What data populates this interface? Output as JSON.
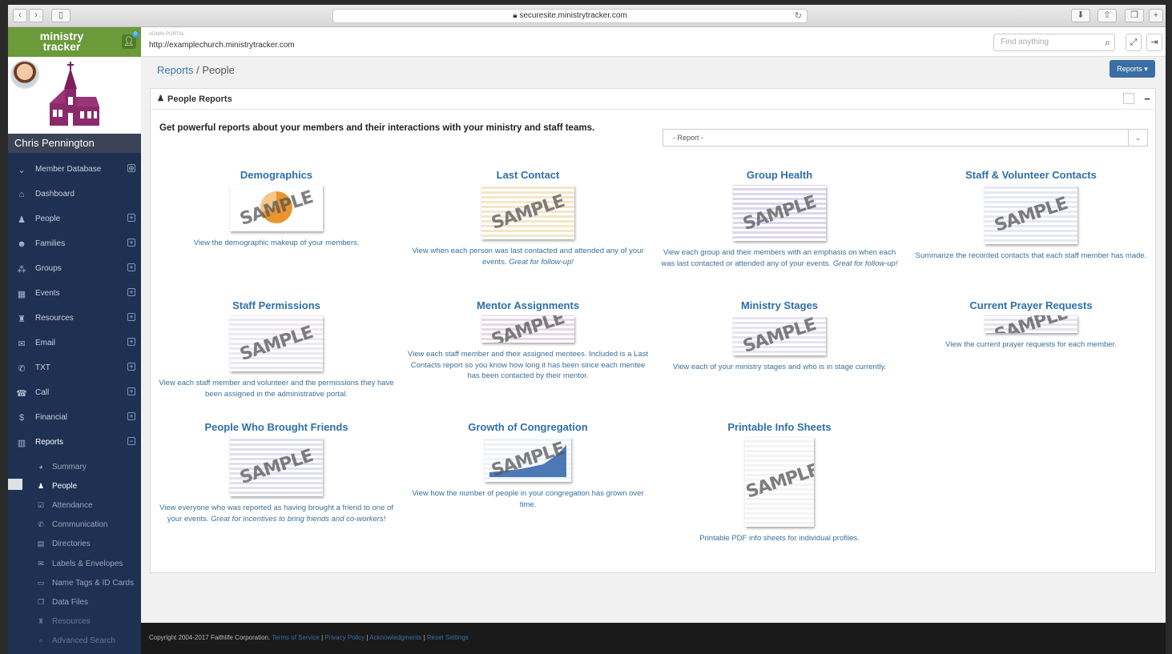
{
  "browser": {
    "address": "securesite.ministrytracker.com"
  },
  "sidebar": {
    "logo_text": "ministry tracker",
    "user_name": "Chris Pennington",
    "items": [
      {
        "label": "Member Database",
        "icon": "chevron-down-icon",
        "glyph": "⌄",
        "expand": "⊕"
      },
      {
        "label": "Dashboard",
        "icon": "home-icon",
        "glyph": "⌂",
        "expand": ""
      },
      {
        "label": "People",
        "icon": "person-icon",
        "glyph": "♟",
        "expand": "+"
      },
      {
        "label": "Families",
        "icon": "family-icon",
        "glyph": "☻",
        "expand": "+"
      },
      {
        "label": "Groups",
        "icon": "groups-icon",
        "glyph": "⁂",
        "expand": "+"
      },
      {
        "label": "Events",
        "icon": "calendar-icon",
        "glyph": "▦",
        "expand": "+"
      },
      {
        "label": "Resources",
        "icon": "resources-icon",
        "glyph": "♜",
        "expand": "+"
      },
      {
        "label": "Email",
        "icon": "email-icon",
        "glyph": "✉",
        "expand": "+"
      },
      {
        "label": "TXT",
        "icon": "chat-icon",
        "glyph": "✆",
        "expand": "+"
      },
      {
        "label": "Call",
        "icon": "phone-icon",
        "glyph": "☎",
        "expand": "+"
      },
      {
        "label": "Financial",
        "icon": "dollar-icon",
        "glyph": "$",
        "expand": "+"
      },
      {
        "label": "Reports",
        "icon": "bar-chart-icon",
        "glyph": "▥",
        "expand": "−"
      }
    ],
    "subitems": [
      {
        "label": "Summary",
        "icon": "pie-icon",
        "glyph": "◕"
      },
      {
        "label": "People",
        "icon": "person-icon",
        "glyph": "♟"
      },
      {
        "label": "Attendance",
        "icon": "check-icon",
        "glyph": "☑"
      },
      {
        "label": "Communication",
        "icon": "chat-icon",
        "glyph": "✆"
      },
      {
        "label": "Directories",
        "icon": "book-icon",
        "glyph": "▤"
      },
      {
        "label": "Labels & Envelopes",
        "icon": "envelope-icon",
        "glyph": "✉"
      },
      {
        "label": "Name Tags & ID Cards",
        "icon": "id-card-icon",
        "glyph": "▭"
      },
      {
        "label": "Data Files",
        "icon": "files-icon",
        "glyph": "❐"
      },
      {
        "label": "Resources",
        "icon": "resources-icon",
        "glyph": "♜"
      },
      {
        "label": "Advanced Search",
        "icon": "search-icon",
        "glyph": "⌕"
      }
    ]
  },
  "header": {
    "portal_label": "ADMIN PORTAL",
    "url": "http://examplechurch.ministrytracker.com",
    "search_placeholder": "Find anything"
  },
  "breadcrumb": {
    "parent": "Reports",
    "sep": " / ",
    "current": "People"
  },
  "reports_button": "Reports ▾",
  "panel": {
    "title": "People Reports",
    "intro": "Get powerful reports about your members and their interactions with your ministry and staff teams.",
    "select_value": "- Report -"
  },
  "sample_text": "SAMPLE",
  "reports": [
    {
      "title": "Demographics",
      "desc": "View the demographic makeup of your members.",
      "em": ""
    },
    {
      "title": "Last Contact",
      "desc": "View when each person was last contacted and attended any of your events. ",
      "em": "Great for follow-up!"
    },
    {
      "title": "Group Health",
      "desc": "View each group and their members with an emphasis on when each was last contacted or attended any of your events. ",
      "em": "Great for follow-up!"
    },
    {
      "title": "Staff & Volunteer Contacts",
      "desc": "Summarize the recorded contacts that each staff member has made.",
      "em": ""
    },
    {
      "title": "Staff Permissions",
      "desc": "View each staff member and volunteer and the permissions they have been assigned in the administrative portal.",
      "em": ""
    },
    {
      "title": "Mentor Assignments",
      "desc": "View each staff member and their assigned mentees. Included is a Last Contacts report so you know how long it has been since each mentee has been contacted by their mentor.",
      "em": ""
    },
    {
      "title": "Ministry Stages",
      "desc": "View each of your ministry stages and who is in stage currently.",
      "em": ""
    },
    {
      "title": "Current Prayer Requests",
      "desc": "View the current prayer requests for each member.",
      "em": ""
    },
    {
      "title": "People Who Brought Friends",
      "desc": "View everyone who was reported as having brought a friend to one of your events. ",
      "em": "Great for incentives to bring friends and co-workers!"
    },
    {
      "title": "Growth of Congregation",
      "desc": "View how the number of people in your congregation has grown over time.",
      "em": ""
    },
    {
      "title": "Printable Info Sheets",
      "desc": "Printable PDF info sheets for individual profiles.",
      "em": ""
    }
  ],
  "footer": {
    "copyright": "Copyright 2004-2017 Faithlife Corporation.",
    "links": [
      "Terms of Service",
      "Privacy Policy",
      "Acknowledgments",
      "Reset Settings"
    ]
  },
  "colors": {
    "sidebar": "#1e3152",
    "brand_green": "#6a9a3a",
    "link_blue": "#2f6fa8",
    "button_blue": "#3a6ea5"
  }
}
